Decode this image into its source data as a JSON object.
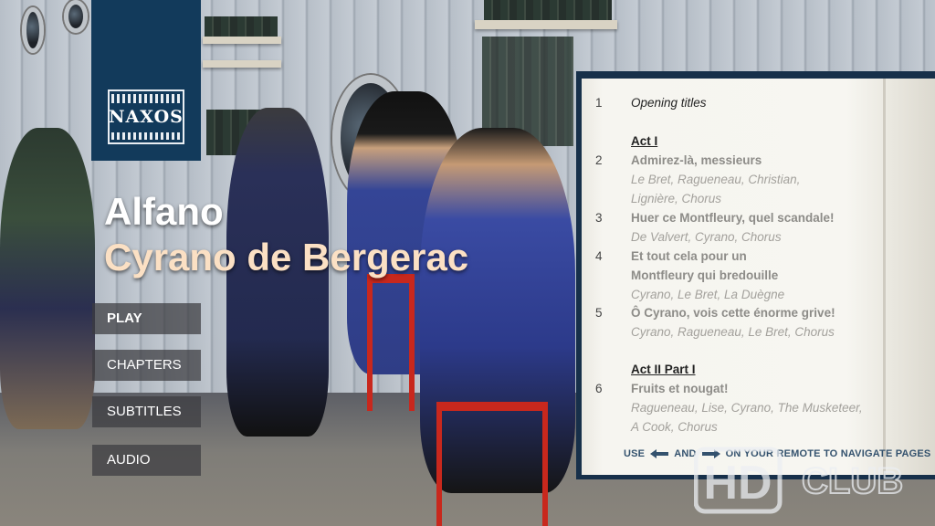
{
  "brand": {
    "logo_text": "NAXOS"
  },
  "title": {
    "composer": "Alfano",
    "opera": "Cyrano de Bergerac"
  },
  "menu": [
    {
      "label": "PLAY",
      "active": true
    },
    {
      "label": "CHAPTERS",
      "active": false
    },
    {
      "label": "SUBTITLES",
      "active": false
    },
    {
      "label": "AUDIO",
      "active": false
    }
  ],
  "chapters": {
    "c1": {
      "num": "1",
      "title": "Opening titles"
    },
    "act1": "Act I",
    "c2": {
      "num": "2",
      "title": "Admirez-là, messieurs",
      "cast1": "Le Bret, Ragueneau, Christian,",
      "cast2": "Lignière, Chorus"
    },
    "c3": {
      "num": "3",
      "title": "Huer ce Montfleury, quel scandale!",
      "cast1": "De Valvert, Cyrano, Chorus"
    },
    "c4": {
      "num": "4",
      "title1": "Et tout cela pour un",
      "title2": "Montfleury qui bredouille",
      "cast1": "Cyrano, Le Bret, La Duègne"
    },
    "c5": {
      "num": "5",
      "title": "Ô Cyrano, vois cette énorme grive!",
      "cast1": "Cyrano, Ragueneau, Le Bret, Chorus"
    },
    "act2": "Act II Part I",
    "c6": {
      "num": "6",
      "title": "Fruits et nougat!",
      "cast1": "Ragueneau, Lise, Cyrano, The Musketeer,",
      "cast2": "A Cook, Chorus"
    }
  },
  "nav_hint": {
    "use": "USE",
    "and": "AND",
    "rest": "ON YOUR REMOTE TO NAVIGATE PAGES"
  },
  "watermark": {
    "hd": "HD",
    "club": "CLUB"
  },
  "colors": {
    "logo_bg": "#123a5b",
    "opera_title": "#fbe0c4",
    "panel_frame": "#17304a",
    "hint": "#34526e"
  }
}
